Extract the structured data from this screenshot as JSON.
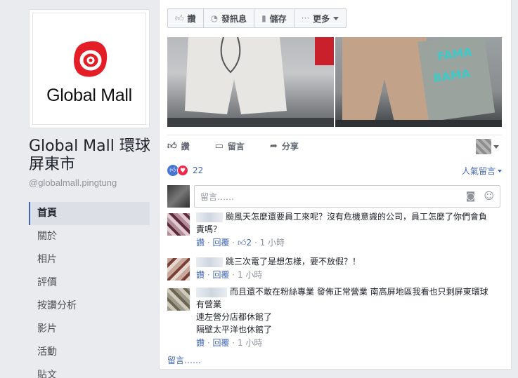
{
  "page": {
    "logo_text": "Global Mall",
    "name": "Global Mall 環球屏東市",
    "handle": "@globalmall.pingtung"
  },
  "nav": [
    {
      "label": "首頁",
      "active": true
    },
    {
      "label": "關於"
    },
    {
      "label": "相片"
    },
    {
      "label": "評價"
    },
    {
      "label": "按讚分析"
    },
    {
      "label": "影片"
    },
    {
      "label": "活動"
    },
    {
      "label": "貼文"
    }
  ],
  "toolbar": {
    "like": "讚",
    "message": "發訊息",
    "save": "儲存",
    "more": "更多"
  },
  "post_actions": {
    "like": "讚",
    "comment": "留言",
    "share": "分享"
  },
  "reactions": {
    "count": "22",
    "sort": "人氣留言"
  },
  "composer": {
    "placeholder": "留言……"
  },
  "comments": [
    {
      "text": "颱風天怎麼還要員工來呢？沒有危機意識的公司，員工怎麼了你們會負責嗎？",
      "like": "讚",
      "reply": "回覆",
      "reactions": "2",
      "time": "1 小時"
    },
    {
      "text": "跳三次電了是想怎樣，要不放假？！",
      "like": "讚",
      "reply": "回覆",
      "time": "1 小時"
    },
    {
      "text_lines": [
        "而且還不敢在粉絲專業 發佈正常營業 南高屏地區我看也只剩屏東環球有營業",
        "連左營分店都休館了",
        "隔壁太平洋也休館了"
      ],
      "like": "讚",
      "reply": "回覆",
      "time": "1 小時"
    }
  ],
  "more_comments": "留言……",
  "colors": {
    "accent": "#4267b2",
    "logo_red": "#e41e26",
    "background": "#e9ebee"
  }
}
